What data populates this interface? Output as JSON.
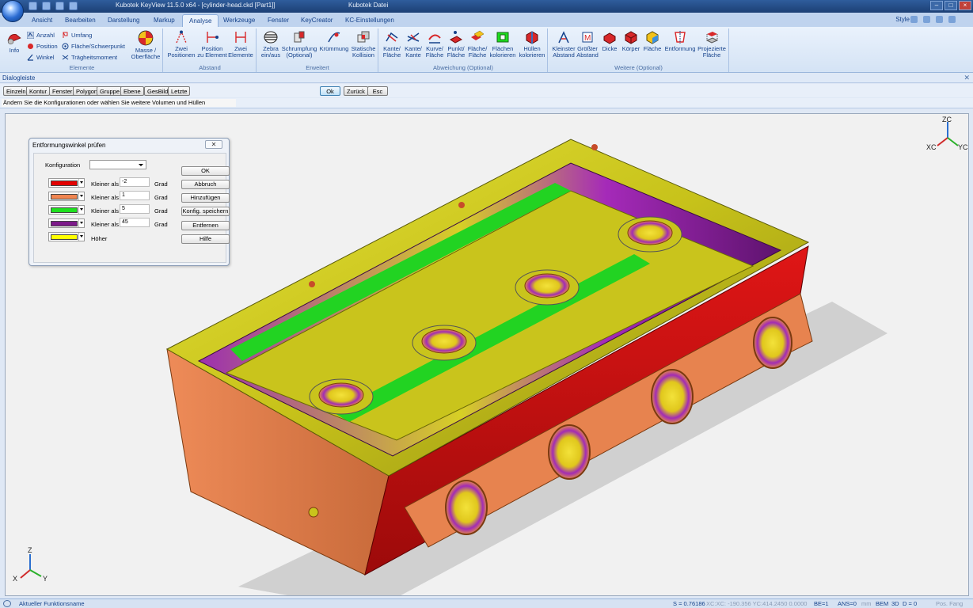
{
  "window": {
    "title": "Kubotek KeyView 11.5.0 x64 - [cylinder-head.ckd [Part1]]",
    "doc_title": "Kubotek Datei"
  },
  "tabs": [
    {
      "label": "Ansicht"
    },
    {
      "label": "Bearbeiten"
    },
    {
      "label": "Darstellung"
    },
    {
      "label": "Markup"
    },
    {
      "label": "Analyse",
      "active": true
    },
    {
      "label": "Werkzeuge"
    },
    {
      "label": "Fenster"
    },
    {
      "label": "KeyCreator"
    },
    {
      "label": "KC-Einstellungen"
    }
  ],
  "style_label": "Style",
  "ribbon": {
    "elemente": {
      "label": "Elemente",
      "info": "Info",
      "anzahl": "Anzahl",
      "position": "Position",
      "winkel": "Winkel",
      "umfang": "Umfang",
      "flaeche_schwerpunkt": "Fläche/Schwerpunkt",
      "traegheitsmoment": "Trägheitsmoment",
      "masse": "Masse /",
      "masse2": "Oberfläche"
    },
    "abstand": {
      "label": "Abstand",
      "zwei_pos": "Zwei",
      "zwei_pos2": "Positionen",
      "pos_elem": "Position",
      "pos_elem2": "zu Element",
      "zwei_elem": "Zwei",
      "zwei_elem2": "Elemente"
    },
    "erweitert": {
      "label": "Erweitert",
      "zebra": "Zebra",
      "zebra2": "ein/aus",
      "schrumpf": "Schrumpfung",
      "schrumpf2": "(Optional)",
      "kruemmung": "Krümmung",
      "statische": "Statische",
      "statische2": "Kollision"
    },
    "abweichung": {
      "label": "Abweichung (Optional)",
      "b1": "Kante/",
      "b1b": "Fläche",
      "b2": "Kante/",
      "b2b": "Kante",
      "b3": "Kurve/",
      "b3b": "Fläche",
      "b4": "Punkt/",
      "b4b": "Fläche",
      "b5": "Fläche/",
      "b5b": "Fläche",
      "b6": "Flächen",
      "b6b": "kolorieren",
      "b7": "Hüllen",
      "b7b": "kolorieren"
    },
    "weitere": {
      "label": "Weitere (Optional)",
      "b1": "Kleinster",
      "b1b": "Abstand",
      "b2": "Größter",
      "b2b": "Abstand",
      "b3": "Dicke",
      "b4": "Körper",
      "b5": "Fläche",
      "b6": "Entformung",
      "b7": "Projezierte",
      "b7b": "Fläche"
    }
  },
  "dialog_bar": {
    "title": "Dialogleiste",
    "buttons": [
      "Einzeln",
      "Kontur",
      "Fenster",
      "Polygon",
      "Gruppe",
      "Ebene",
      "GesBild",
      "Letzte"
    ],
    "ok": "Ok",
    "back": "Zurück",
    "esc": "Esc",
    "prompt": "Ändern Sie die Konfigurationen oder wählen Sie weitere Volumen und Hüllen"
  },
  "draft_dialog": {
    "title": "Entformungswinkel prüfen",
    "close_glyph": "✕",
    "config_label": "Konfiguration",
    "config_value": "",
    "rows": [
      {
        "color": "#e30000",
        "label": "Kleiner als",
        "value": "-2",
        "unit": "Grad"
      },
      {
        "color": "#f08550",
        "label": "Kleiner als",
        "value": "1",
        "unit": "Grad"
      },
      {
        "color": "#1ee01e",
        "label": "Kleiner als",
        "value": "5",
        "unit": "Grad"
      },
      {
        "color": "#7d1a8a",
        "label": "Kleiner als",
        "value": "45",
        "unit": "Grad"
      },
      {
        "color": "#ffff00",
        "label": "Höher",
        "value": "",
        "unit": ""
      }
    ],
    "buttons": {
      "ok": "OK",
      "cancel": "Abbruch",
      "add": "Hinzufügen",
      "save": "Konfig. speichern",
      "remove": "Entfernen",
      "help": "Hilfe"
    }
  },
  "view_triad": {
    "z": "ZC",
    "x": "XC",
    "y": "YC"
  },
  "world_triad": {
    "z": "Z",
    "x": "X",
    "y": "Y"
  },
  "status_bar": {
    "function_name": "Aktueller Funktionsname",
    "scale": "S = 0.76186",
    "coords": "XC:XC: -190.356 YC:414.2450 0.0000",
    "be": "BE=1",
    "ans": "ANS=0",
    "unit": "mm",
    "bem": "BEM",
    "mode": "3D",
    "d": "D = 0",
    "pos": "Pos. Fang"
  },
  "icons": [
    "app-orb-icon",
    "info-icon",
    "draft-angle-icon",
    "zebra-icon",
    "axis-triad-icon"
  ]
}
